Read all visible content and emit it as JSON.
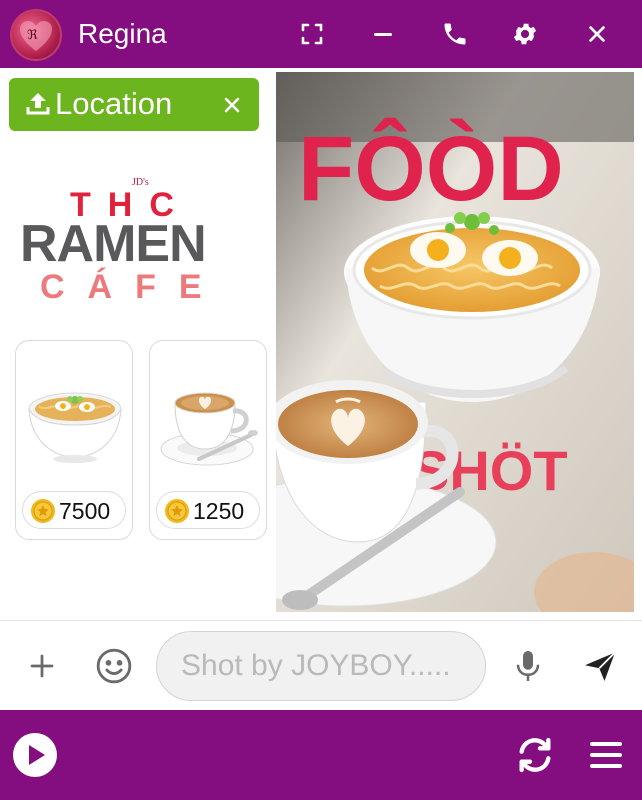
{
  "header": {
    "contact_name": "Regina",
    "icons": [
      "avatar",
      "fullscreen-icon",
      "minimize-icon",
      "phone-icon",
      "gear-icon",
      "close-icon"
    ]
  },
  "location_chip": {
    "label": "Location",
    "icon": "upload-icon",
    "close_icon": "close-icon"
  },
  "logo": {
    "small_text": "JD's",
    "line1": "THC",
    "line2": "RAMEN",
    "line3": "CÁFE"
  },
  "menu_items": [
    {
      "name": "ramen bowl",
      "icon": "coin-icon",
      "price": "7500"
    },
    {
      "name": "latte",
      "icon": "coin-icon",
      "price": "1250"
    }
  ],
  "photo": {
    "headline_top": "FÔÒD",
    "headline_bottom": "SHÖT"
  },
  "composer": {
    "placeholder": "Shot by JOYBOY.....",
    "value": ""
  },
  "colors": {
    "bar_purple": "#840d80",
    "chip_green": "#6db51f",
    "title_red": "#e2213a",
    "title_gray": "#59595b",
    "title_pink": "#ec7a7c"
  }
}
